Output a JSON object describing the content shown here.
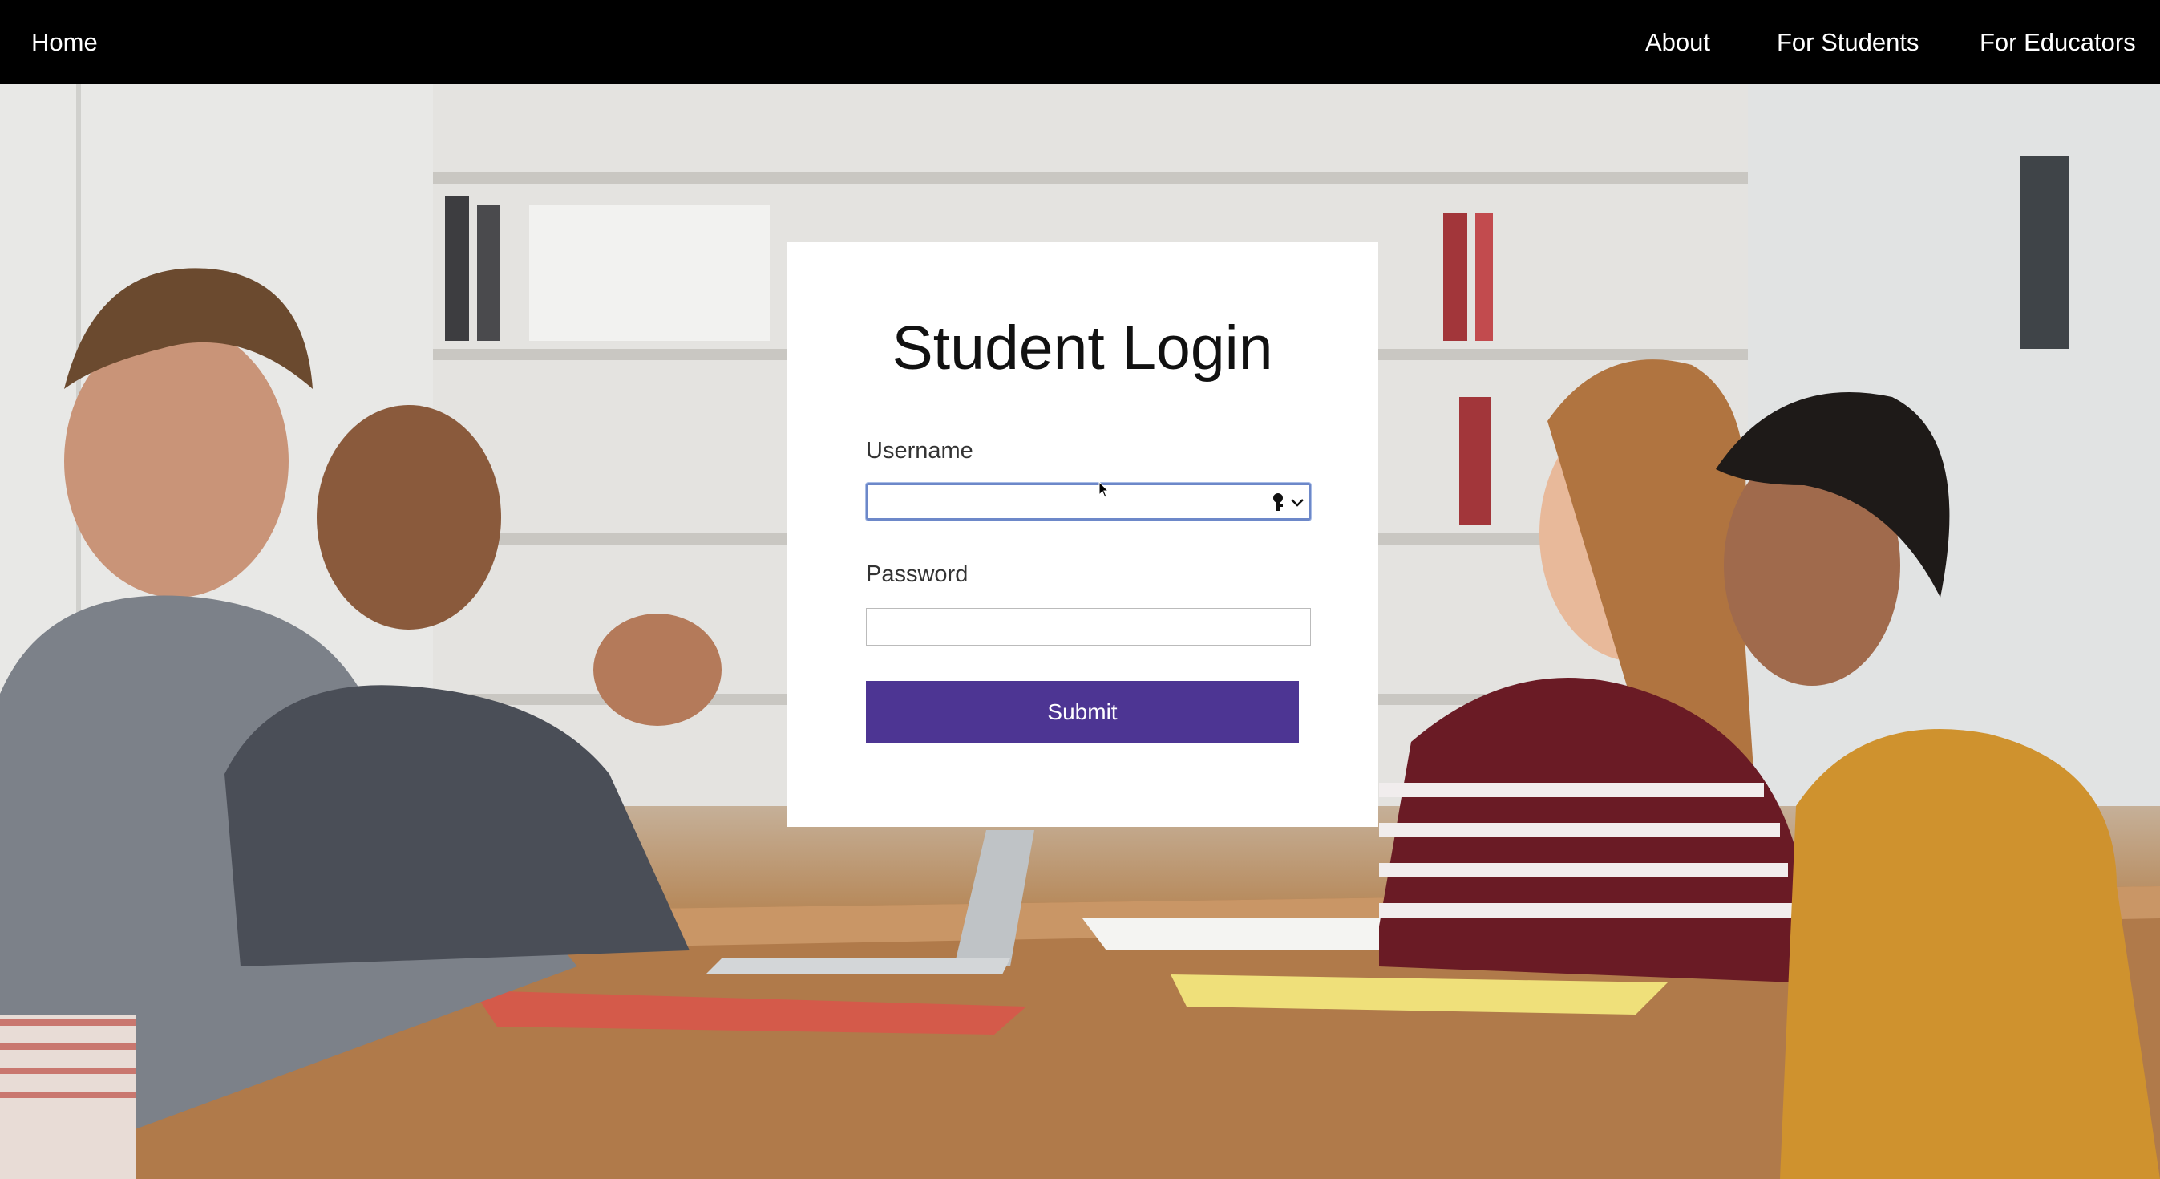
{
  "nav": {
    "home": "Home",
    "about": "About",
    "for_students": "For Students",
    "for_educators": "For Educators"
  },
  "login": {
    "title": "Student Login",
    "username_label": "Username",
    "username_value": "",
    "password_label": "Password",
    "password_value": "",
    "submit_label": "Submit"
  },
  "colors": {
    "navbar": "#000000",
    "submit_button": "#4d3593",
    "focus_ring": "#6d88c9"
  },
  "icons": {
    "credential_autofill": "key-icon",
    "dropdown": "chevron-down-icon"
  }
}
